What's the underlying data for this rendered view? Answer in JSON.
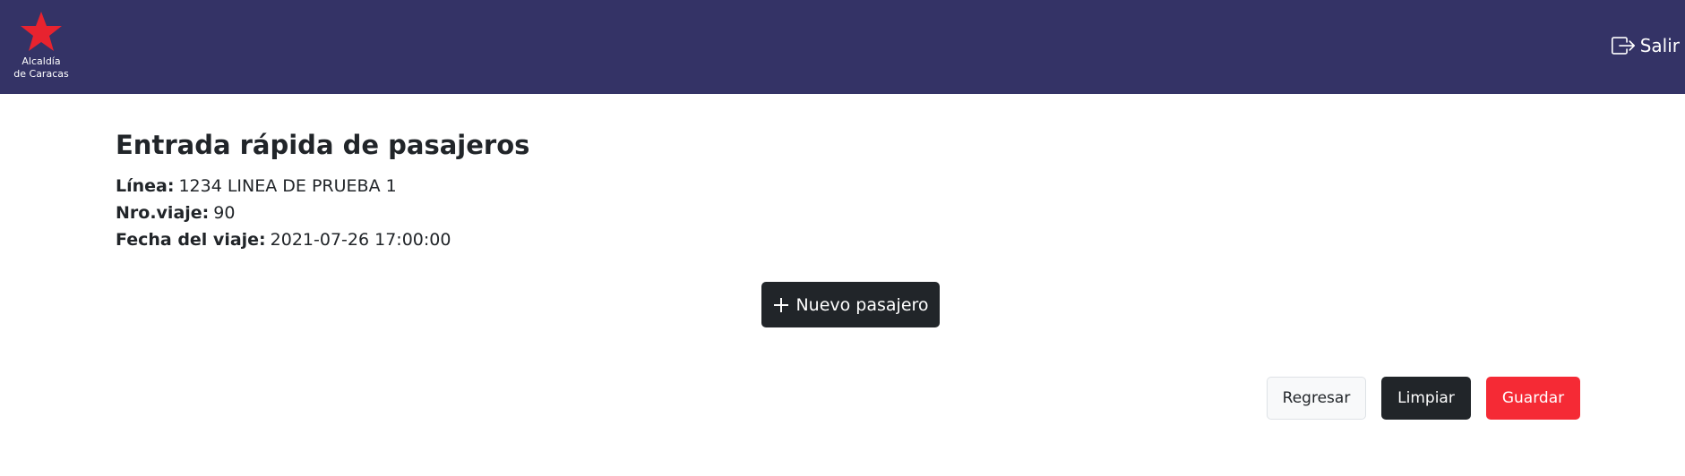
{
  "navbar": {
    "logo": {
      "line1": "Alcaldía",
      "line2": "de Caracas",
      "icon": "star-icon",
      "color": "#e8232f"
    },
    "logout_label": "Salir",
    "logout_icon": "logout-icon",
    "background": "#343366"
  },
  "page": {
    "title": "Entrada rápida de pasajeros",
    "linea_label": "Línea:",
    "linea_value": "1234 LINEA DE PRUEBA 1",
    "viaje_label": "Nro.viaje:",
    "viaje_value": "90",
    "fecha_label": "Fecha del viaje:",
    "fecha_value": "2021-07-26 17:00:00"
  },
  "actions": {
    "new_passenger_label": "Nuevo pasajero",
    "new_passenger_icon": "plus-icon",
    "back_label": "Regresar",
    "clear_label": "Limpiar",
    "save_label": "Guardar",
    "save_color": "#f52a35"
  }
}
